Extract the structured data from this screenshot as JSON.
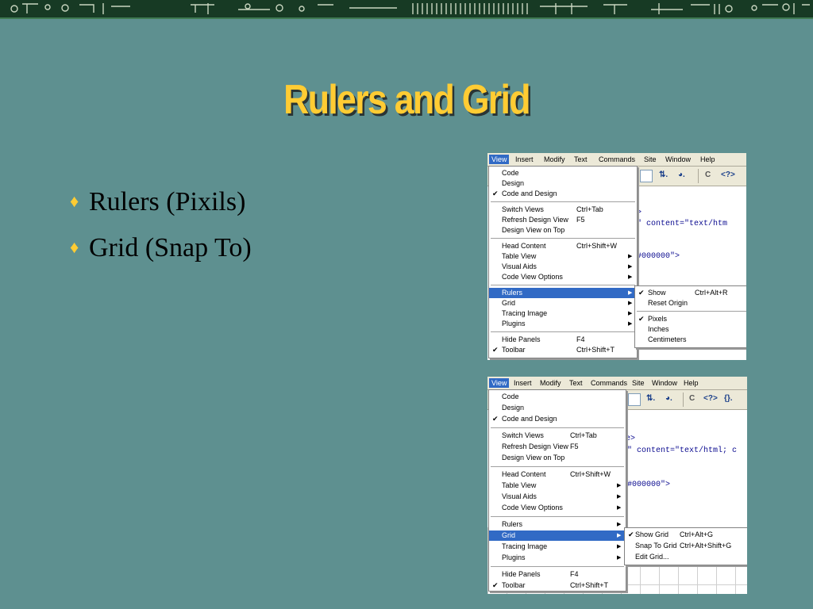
{
  "slide": {
    "title": "Rulers and Grid",
    "bullets": [
      {
        "marker": "♦",
        "text": "Rulers (Pixils)"
      },
      {
        "marker": "♦",
        "text": "Grid (Snap To)"
      }
    ]
  },
  "colors": {
    "background": "#5e9090",
    "title": "#ffcc33",
    "highlight": "#316ac5"
  },
  "screenshot1": {
    "menubar": [
      "View",
      "Insert",
      "Modify",
      "Text",
      "Commands",
      "Site",
      "Window",
      "Help"
    ],
    "toolbar": {
      "file_mgmt": "⇅.",
      "preview": "◕.",
      "refresh": "C",
      "code_nav": "<?>"
    },
    "code": [
      ">",
      "\" content=\"text/htm",
      "#000000\">"
    ],
    "view_menu": {
      "code": "Code",
      "design": "Design",
      "code_and_design": "Code and Design",
      "switch_views": "Switch Views",
      "switch_views_sc": "Ctrl+Tab",
      "refresh": "Refresh Design View",
      "refresh_sc": "F5",
      "design_on_top": "Design View on Top",
      "head_content": "Head Content",
      "head_content_sc": "Ctrl+Shift+W",
      "table_view": "Table View",
      "visual_aids": "Visual Aids",
      "code_view_options": "Code View Options",
      "rulers": "Rulers",
      "grid": "Grid",
      "tracing_image": "Tracing Image",
      "plugins": "Plugins",
      "hide_panels": "Hide Panels",
      "hide_panels_sc": "F4",
      "toolbar": "Toolbar",
      "toolbar_sc": "Ctrl+Shift+T"
    },
    "rulers_submenu": {
      "show": "Show",
      "show_sc": "Ctrl+Alt+R",
      "reset_origin": "Reset Origin",
      "pixels": "Pixels",
      "inches": "Inches",
      "centimeters": "Centimeters"
    }
  },
  "screenshot2": {
    "menubar": [
      "View",
      "Insert",
      "Modify",
      "Text",
      "Commands",
      "Site",
      "Window",
      "Help"
    ],
    "toolbar": {
      "file_mgmt": "⇅.",
      "preview": "◕.",
      "refresh": "C",
      "code_nav": "<?>",
      "braces": "{}."
    },
    "code": [
      "e>",
      "\" content=\"text/html; c",
      "#000000\">"
    ],
    "view_menu": {
      "code": "Code",
      "design": "Design",
      "code_and_design": "Code and Design",
      "switch_views": "Switch Views",
      "switch_views_sc": "Ctrl+Tab",
      "refresh": "Refresh Design View",
      "refresh_sc": "F5",
      "design_on_top": "Design View on Top",
      "head_content": "Head Content",
      "head_content_sc": "Ctrl+Shift+W",
      "table_view": "Table View",
      "visual_aids": "Visual Aids",
      "code_view_options": "Code View Options",
      "rulers": "Rulers",
      "grid": "Grid",
      "tracing_image": "Tracing Image",
      "plugins": "Plugins",
      "hide_panels": "Hide Panels",
      "hide_panels_sc": "F4",
      "toolbar": "Toolbar",
      "toolbar_sc": "Ctrl+Shift+T"
    },
    "grid_submenu": {
      "show_grid": "Show Grid",
      "show_grid_sc": "Ctrl+Alt+G",
      "snap_to_grid": "Snap To Grid",
      "snap_to_grid_sc": "Ctrl+Alt+Shift+G",
      "edit_grid": "Edit Grid..."
    }
  }
}
